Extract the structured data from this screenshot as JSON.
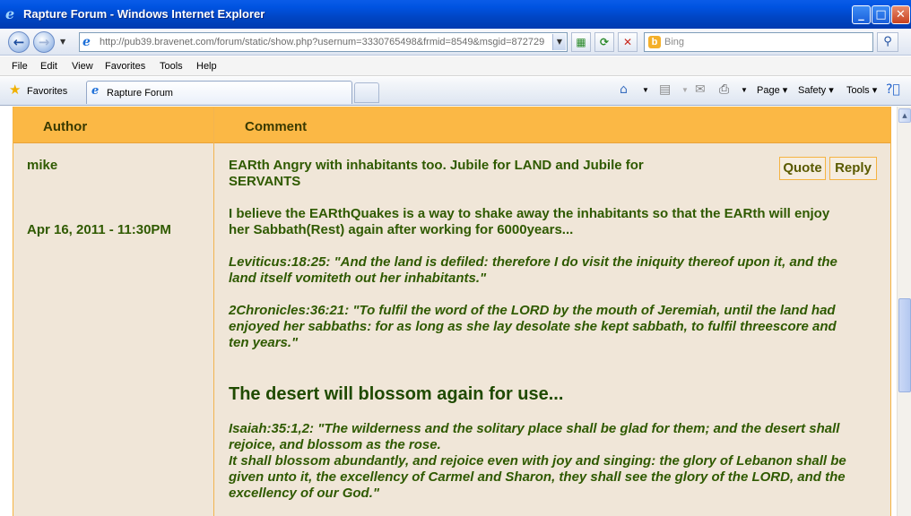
{
  "window": {
    "title": "Rapture Forum - Windows Internet Explorer",
    "minimize_icon": "minimize-icon",
    "maximize_icon": "maximize-icon",
    "close_icon": "close-icon"
  },
  "address": {
    "url": "http://pub39.bravenet.com/forum/static/show.php?usernum=3330765498&frmid=8549&msgid=872729",
    "search_placeholder": "Bing"
  },
  "menu": [
    "File",
    "Edit",
    "View",
    "Favorites",
    "Tools",
    "Help"
  ],
  "favorites_label": "Favorites",
  "tab": {
    "title": "Rapture Forum"
  },
  "commands": {
    "page": "Page ▾",
    "safety": "Safety ▾",
    "tools": "Tools ▾"
  },
  "forum": {
    "headers": {
      "author": "Author",
      "comment": "Comment"
    },
    "post": {
      "author": "mike",
      "date": "Apr 16, 2011 - 11:30PM",
      "title_line1": "EARth Angry with inhabitants too. Jubile for LAND and Jubile for",
      "title_line2": "SERVANTS",
      "quote_label": "Quote",
      "reply_label": "Reply",
      "p1_line1": "I believe the EARthQuakes is a way to shake away the inhabitants so that the EARth will enjoy",
      "p1_line2": "her Sabbath(Rest) again after working for 6000years...",
      "p2_line1": "Leviticus:18:25: \"And the land is defiled: therefore I do visit the iniquity thereof upon it, and the",
      "p2_line2": "land itself vomiteth out her inhabitants.\"",
      "p3_line1": "2Chronicles:36:21: \"To fulfil the word of the LORD by the mouth of Jeremiah, until the land had",
      "p3_line2": "enjoyed her sabbaths: for as long as she lay desolate she kept sabbath, to fulfil threescore and",
      "p3_line3": "ten years.\"",
      "heading": "The desert will blossom again for use...",
      "p4_line1": "Isaiah:35:1,2: \"The wilderness and the solitary place shall be glad for them; and the desert shall",
      "p4_line2": "rejoice, and blossom as the rose.",
      "p4_line3": "It shall blossom abundantly, and rejoice even with joy and singing: the glory of Lebanon shall be",
      "p4_line4": "given unto it, the excellency of Carmel and Sharon, they shall see the glory of the LORD, and the",
      "p4_line5": "excellency of our God.\""
    }
  },
  "colors": {
    "header_bg": "#fbb845",
    "body_bg": "#f0e6d8",
    "text_green": "#2f5a00",
    "titlebar_blue": "#0053e1"
  }
}
